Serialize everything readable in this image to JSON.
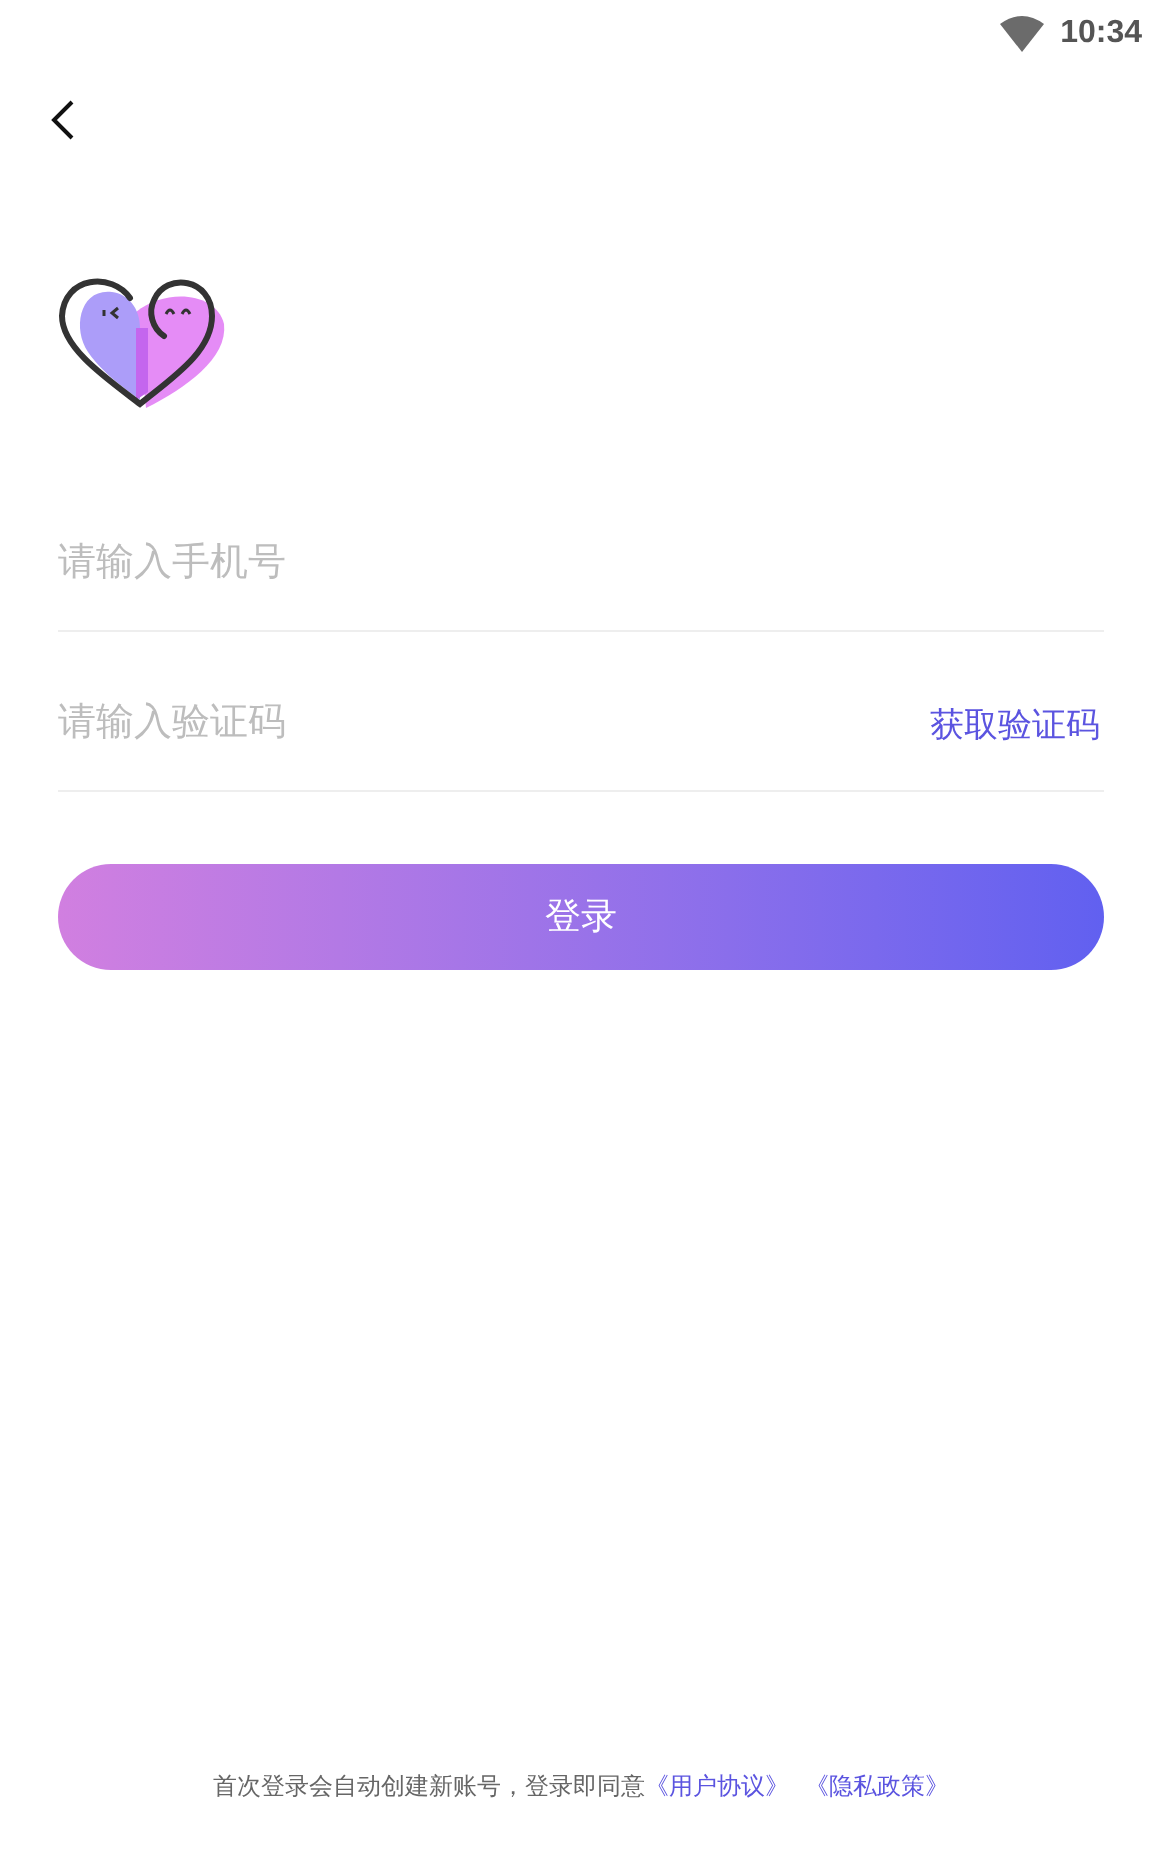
{
  "status_bar": {
    "time": "10:34"
  },
  "phone_field": {
    "placeholder": "请输入手机号"
  },
  "code_field": {
    "placeholder": "请输入验证码"
  },
  "get_code_link": "获取验证码",
  "login_button": "登录",
  "footer": {
    "text": "首次登录会自动创建新账号，登录即同意",
    "links": [
      "《用户协议》",
      "《隐私政策》"
    ]
  }
}
